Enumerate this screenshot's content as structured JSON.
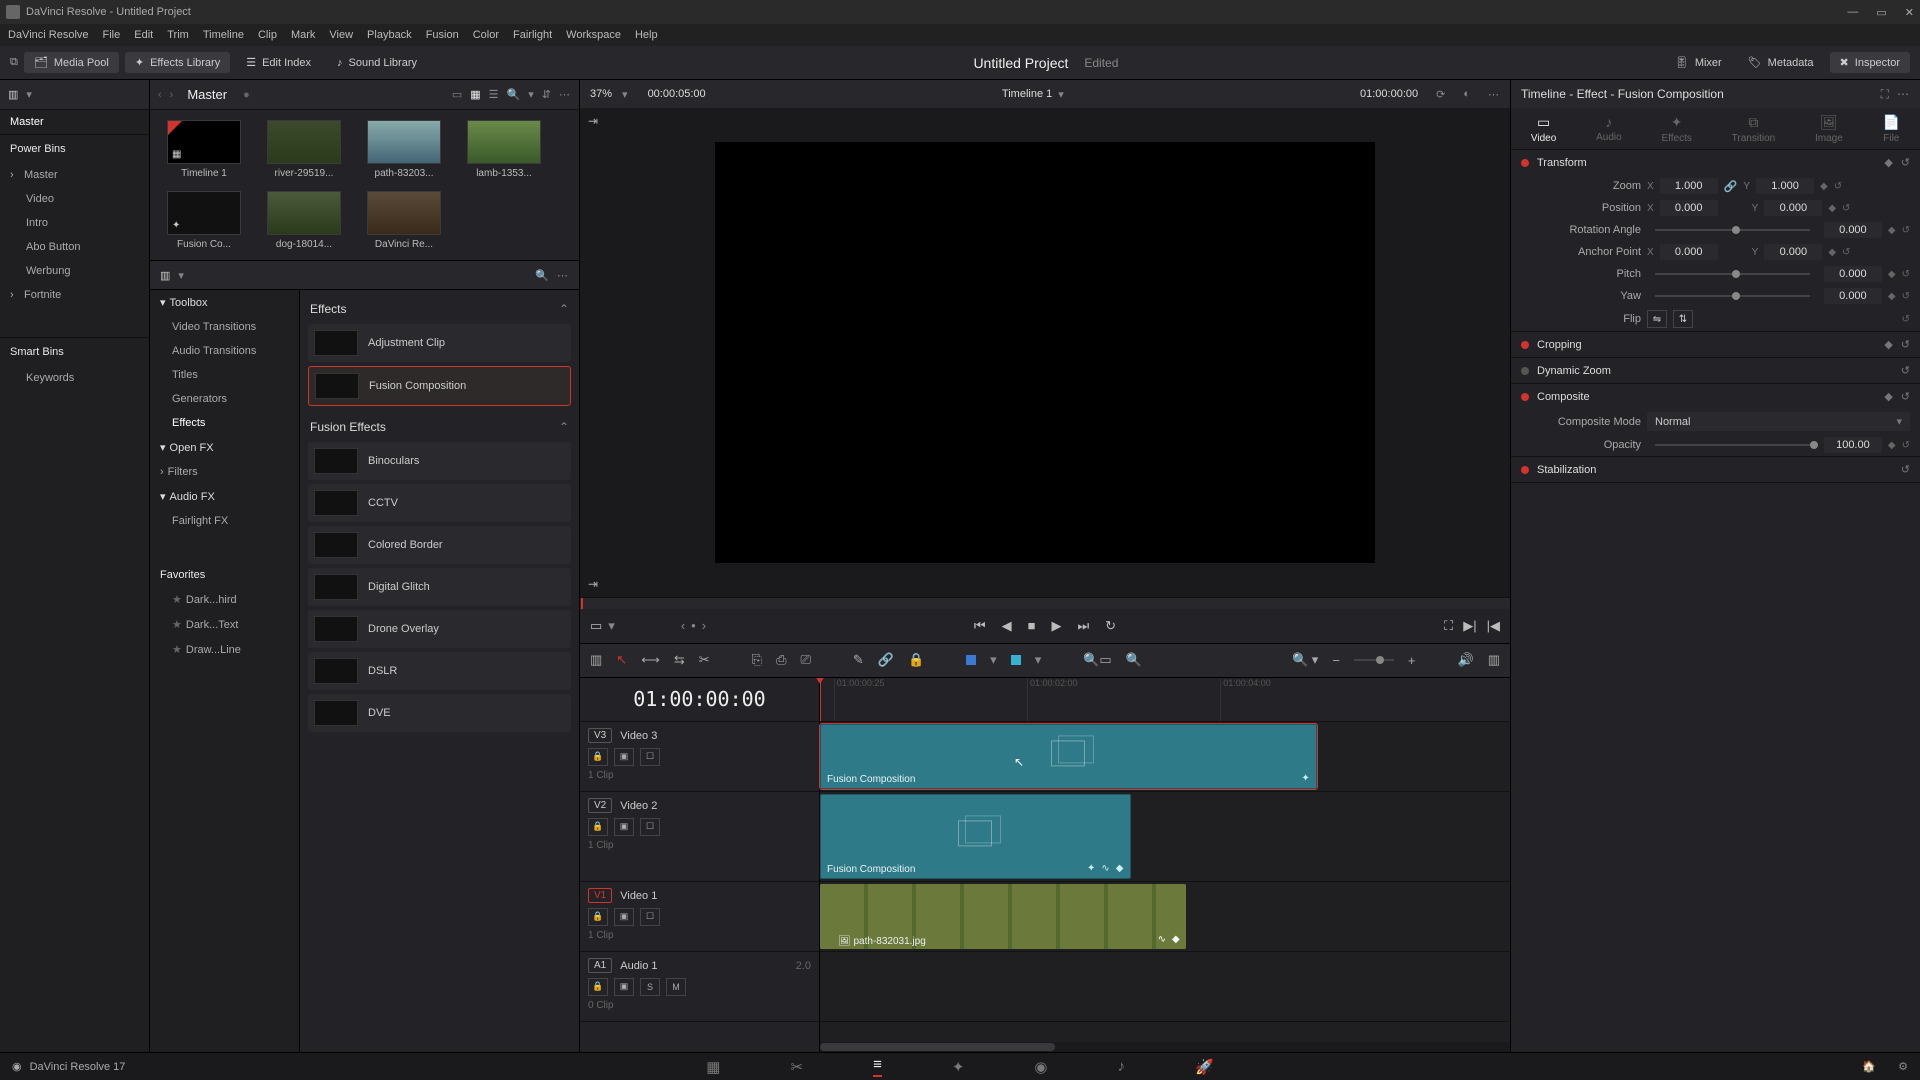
{
  "window": {
    "title": "DaVinci Resolve - Untitled Project"
  },
  "menu": [
    "DaVinci Resolve",
    "File",
    "Edit",
    "Trim",
    "Timeline",
    "Clip",
    "Mark",
    "View",
    "Playback",
    "Fusion",
    "Color",
    "Fairlight",
    "Workspace",
    "Help"
  ],
  "toolbar": {
    "media_pool": "Media Pool",
    "effects_lib": "Effects Library",
    "edit_index": "Edit Index",
    "sound_lib": "Sound Library",
    "project": "Untitled Project",
    "edited": "Edited",
    "mixer": "Mixer",
    "metadata": "Metadata",
    "inspector": "Inspector"
  },
  "pool": {
    "breadcrumb": "Master",
    "zoom": "37%",
    "tc": "00:00:05:00",
    "tl_name": "Timeline 1",
    "tl_tc": "01:00:00:00",
    "master": "Master",
    "power_bins": "Power Bins",
    "bins": [
      "Master",
      "Video",
      "Intro",
      "Abo Button",
      "Werbung",
      "Fortnite"
    ],
    "smart": "Smart Bins",
    "keywords": "Keywords",
    "thumbs": [
      "Timeline 1",
      "river-29519...",
      "path-83203...",
      "lamb-1353...",
      "Fusion Co...",
      "dog-18014...",
      "DaVinci Re..."
    ]
  },
  "fx": {
    "cats": {
      "toolbox": "Toolbox",
      "vt": "Video Transitions",
      "at": "Audio Transitions",
      "titles": "Titles",
      "gen": "Generators",
      "effects": "Effects",
      "openfx": "Open FX",
      "filters": "Filters",
      "audiofx": "Audio FX",
      "flfx": "Fairlight FX",
      "fav": "Favorites"
    },
    "favs": [
      "Dark...hird",
      "Dark...Text",
      "Draw...Line"
    ],
    "sec_effects": "Effects",
    "adj": "Adjustment Clip",
    "fcomp": "Fusion Composition",
    "sec_fusion": "Fusion Effects",
    "list": [
      "Binoculars",
      "CCTV",
      "Colored Border",
      "Digital Glitch",
      "Drone Overlay",
      "DSLR",
      "DVE"
    ]
  },
  "transport": {
    "tc": "01:00:00:00"
  },
  "ruler": [
    "01:00:00:25",
    "01:00:02:00",
    "01:00:04:00"
  ],
  "tracks": {
    "v3": {
      "tag": "V3",
      "name": "Video 3",
      "meta": "1 Clip",
      "clip": "Fusion Composition"
    },
    "v2": {
      "tag": "V2",
      "name": "Video 2",
      "meta": "1 Clip",
      "clip": "Fusion Composition"
    },
    "v1": {
      "tag": "V1",
      "name": "Video 1",
      "meta": "1 Clip",
      "clip": "path-832031.jpg"
    },
    "a1": {
      "tag": "A1",
      "name": "Audio 1",
      "ch": "2.0",
      "meta": "0 Clip"
    }
  },
  "inspector": {
    "title": "Timeline - Effect - Fusion Composition",
    "tabs": [
      "Video",
      "Audio",
      "Effects",
      "Transition",
      "Image",
      "File"
    ],
    "transform": {
      "hdr": "Transform",
      "zoom": "Zoom",
      "zx": "1.000",
      "zy": "1.000",
      "position": "Position",
      "px": "0.000",
      "py": "0.000",
      "rot": "Rotation Angle",
      "rv": "0.000",
      "anchor": "Anchor Point",
      "ax": "0.000",
      "ay": "0.000",
      "pitch": "Pitch",
      "pv": "0.000",
      "yaw": "Yaw",
      "yv": "0.000",
      "flip": "Flip"
    },
    "cropping": "Cropping",
    "dynzoom": "Dynamic Zoom",
    "composite": {
      "hdr": "Composite",
      "mode_l": "Composite Mode",
      "mode_v": "Normal",
      "opacity_l": "Opacity",
      "opacity_v": "100.00"
    },
    "stab": "Stabilization"
  },
  "pagebar": {
    "brand": "DaVinci Resolve 17"
  }
}
